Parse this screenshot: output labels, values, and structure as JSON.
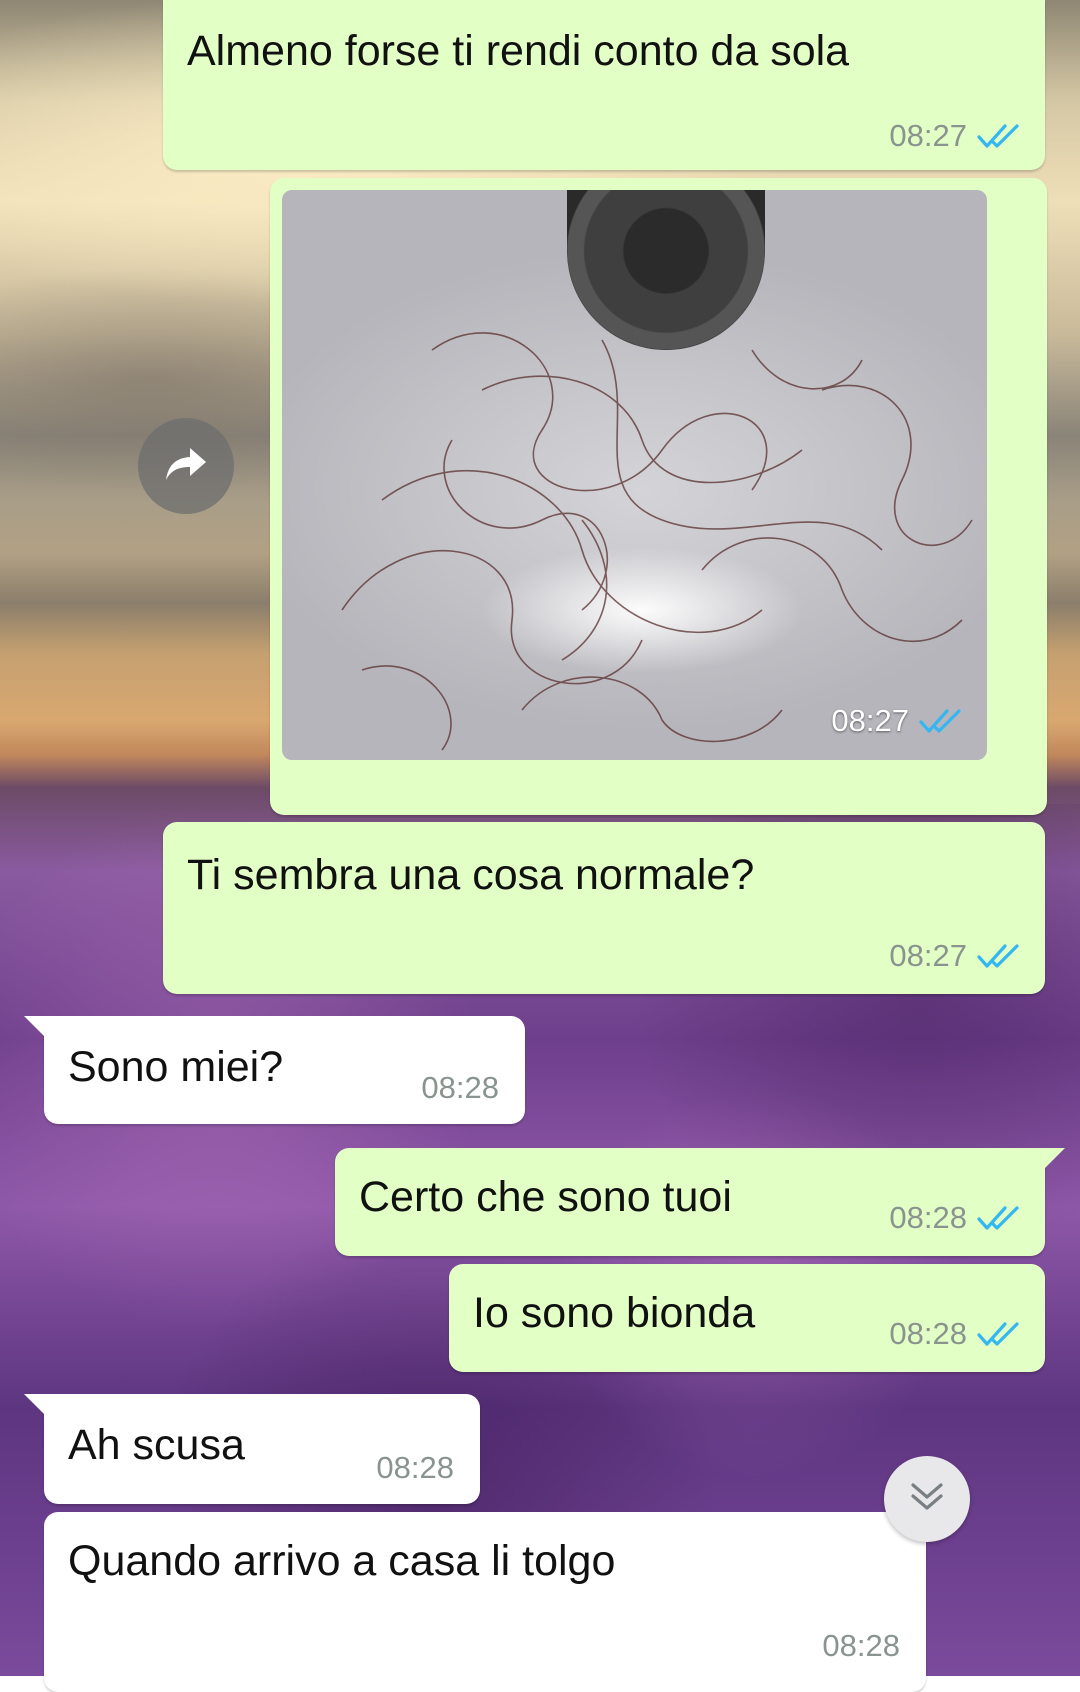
{
  "colors": {
    "outgoing_bubble": "#e2ffc6",
    "incoming_bubble": "#ffffff",
    "read_ticks": "#34b7f1",
    "timestamp": "#8a948f"
  },
  "messages": [
    {
      "direction": "outgoing",
      "text": "Almeno forse ti rendi conto da sola",
      "time": "08:27",
      "status": "read"
    },
    {
      "direction": "outgoing",
      "type": "image",
      "time": "08:27",
      "status": "read"
    },
    {
      "direction": "outgoing",
      "text": "Ti sembra una cosa normale?",
      "time": "08:27",
      "status": "read"
    },
    {
      "direction": "incoming",
      "text": "Sono miei?",
      "time": "08:28"
    },
    {
      "direction": "outgoing",
      "text": "Certo che sono tuoi",
      "time": "08:28",
      "status": "read"
    },
    {
      "direction": "outgoing",
      "text": "Io sono bionda",
      "time": "08:28",
      "status": "read"
    },
    {
      "direction": "incoming",
      "text": "Ah scusa",
      "time": "08:28"
    },
    {
      "direction": "incoming",
      "text": "Quando arrivo a casa li tolgo",
      "time": "08:28"
    }
  ],
  "icons": {
    "forward": "forward-arrow-icon",
    "read": "double-check-icon",
    "scroll_down": "double-chevron-down-icon"
  }
}
